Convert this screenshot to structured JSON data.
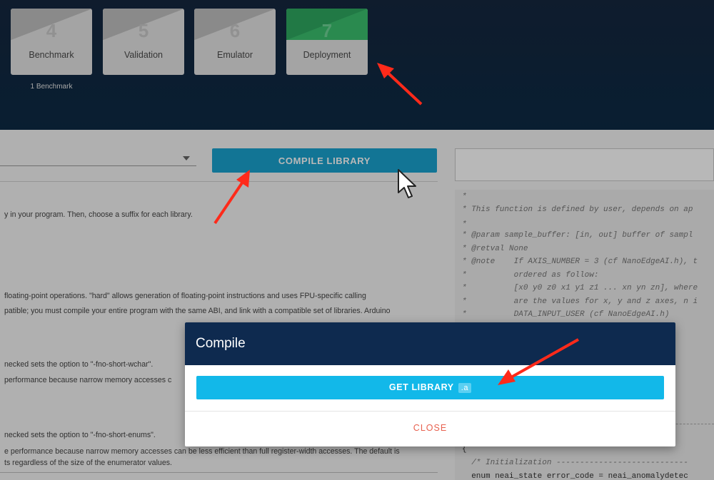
{
  "steps": [
    {
      "number": "4",
      "label": "Benchmark",
      "sub": "1 Benchmark",
      "active": false
    },
    {
      "number": "5",
      "label": "Validation",
      "active": false
    },
    {
      "number": "6",
      "label": "Emulator",
      "active": false
    },
    {
      "number": "7",
      "label": "Deployment",
      "active": true
    }
  ],
  "toolbar": {
    "compile_label": "COMPILE LIBRARY"
  },
  "left_text": [
    "y in your program. Then, choose a suffix for each library.",
    "floating-point operations. \"hard\" allows generation of floating-point instructions and uses FPU-specific calling",
    "patible; you must compile your entire program with the same ABI, and link with a compatible set of libraries. Arduino",
    "necked sets the option to \"-fno-short-wchar\".",
    "performance because narrow memory accesses c",
    "necked sets the option to \"-fno-short-enums\".",
    "e performance because narrow memory accesses can be less efficient than full register-width accesses. The default is",
    "ts regardless of the size of the enumerator values."
  ],
  "code_lines": [
    "*",
    "* This function is defined by user, depends on ap",
    "*",
    "* @param sample_buffer: [in, out] buffer of sampl",
    "* @retval None",
    "* @note    If AXIS_NUMBER = 3 (cf NanoEdgeAI.h), t",
    "*          ordered as follow:",
    "*          [x0 y0 z0 x1 y1 z1 ... xn yn zn], where",
    "*          are the values for x, y and z axes, n i",
    "*          DATA_INPUT_USER (cf NanoEdgeAI.h)",
    "{",
    "  /* Initialization ----------------------------",
    "  enum neai_state error_code = neai_anomalydetec"
  ],
  "modal": {
    "title": "Compile",
    "get_label": "GET LIBRARY",
    "get_ext": ".a",
    "close_label": "CLOSE"
  },
  "colors": {
    "header": "#0d2a45",
    "compile_button": "#1aa3cf",
    "get_button": "#12b8e9",
    "close_text": "#e8614f",
    "arrow": "#ff2a1a",
    "active_step": "#2ea860"
  },
  "icons": {
    "dropdown": "chevron-down-icon",
    "cursor": "mouse-pointer-icon",
    "annotations": "red-arrow-icon"
  }
}
